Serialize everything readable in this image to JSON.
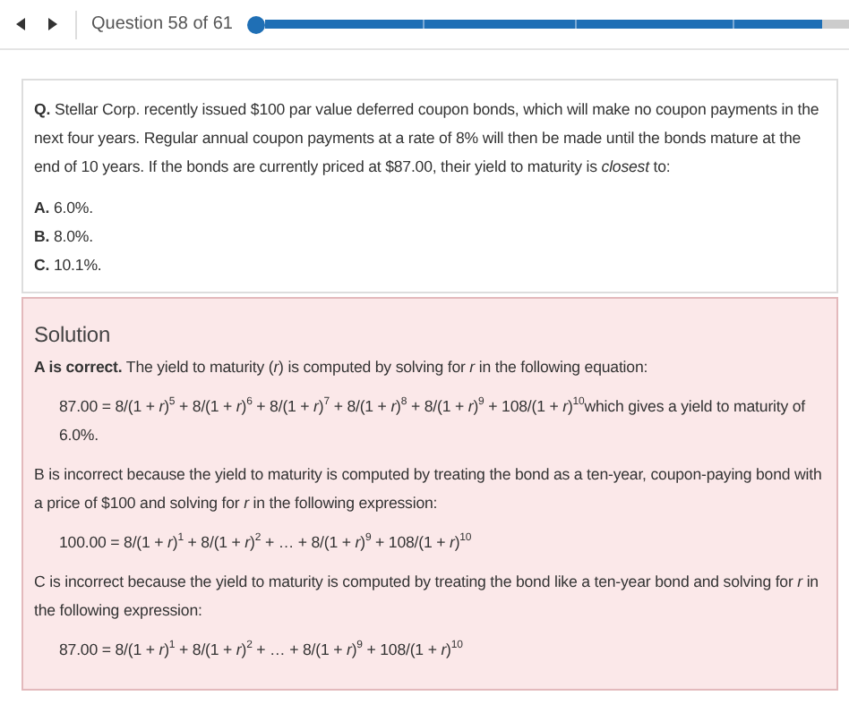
{
  "nav": {
    "counter": "Question 58 of 61",
    "progress": {
      "level": 0.955
    }
  },
  "question": {
    "label": "Q.",
    "text": "Stellar Corp. recently issued $100 par value deferred coupon bonds, which will make no coupon payments in the next four years. Regular annual coupon payments at a rate of 8% will then be made until the bonds mature at the end of 10 years. If the bonds are currently priced at $87.00, their yield to maturity is *closest* to:",
    "options": [
      {
        "letter": "A.",
        "text": "6.0%."
      },
      {
        "letter": "B.",
        "text": "8.0%."
      },
      {
        "letter": "C.",
        "text": "10.1%."
      }
    ]
  },
  "solution": {
    "title": "Solution",
    "blocks": [
      {
        "kind": "paragraph",
        "text": "**A is correct.** The yield to maturity (*r*) is computed by solving for *r* in the following equation:"
      },
      {
        "kind": "equation",
        "text": "87.00 = 8/(1 + *r*)$^{5}$ + 8/(1 + *r*)$^{6}$ + 8/(1 + *r*)$^{7}$ + 8/(1 + *r*)$^{8}$ + 8/(1 + *r*)$^{9}$ + 108/(1 + *r*)$^{10}$which gives a yield to maturity of 6.0%."
      },
      {
        "kind": "paragraph",
        "text": "B is incorrect because the yield to maturity is computed by treating the bond as a ten-year, coupon-paying bond with a price of $100 and solving for *r* in the following expression:"
      },
      {
        "kind": "equation",
        "text": "100.00 = 8/(1 + *r*)$^{1}$ + 8/(1 + *r*)$^{2}$ + … + 8/(1 + *r*)$^{9}$ + 108/(1 + *r*)$^{10}$"
      },
      {
        "kind": "paragraph",
        "text": "C is incorrect because the yield to maturity is computed by treating the bond like a ten-year bond and solving for *r* in the following expression:"
      },
      {
        "kind": "equation",
        "text": "87.00 = 8/(1 + *r*)$^{1}$ + 8/(1 + *r*)$^{2}$ + … + 8/(1 + *r*)$^{9}$ + 108/(1 + *r*)$^{10}$"
      }
    ]
  }
}
